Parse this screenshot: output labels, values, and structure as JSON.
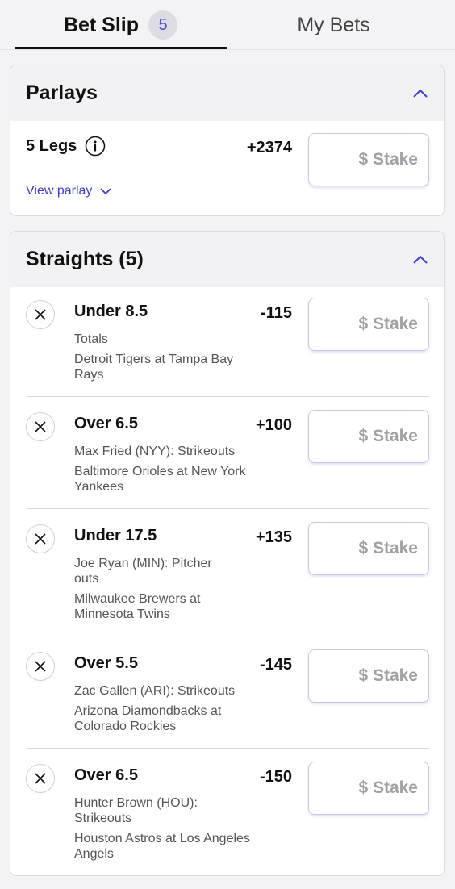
{
  "tabs": {
    "bet_slip_label": "Bet Slip",
    "bet_slip_count": "5",
    "my_bets_label": "My Bets"
  },
  "parlays": {
    "title": "Parlays",
    "legs_label": "5 Legs",
    "odds": "+2374",
    "view_label": "View parlay",
    "stake_placeholder": "$ Stake"
  },
  "straights": {
    "title": "Straights (5)",
    "items": [
      {
        "selection": "Under 8.5",
        "odds": "-115",
        "market": "Totals",
        "event": "Detroit Tigers at Tampa Bay Rays",
        "stake_placeholder": "$ Stake"
      },
      {
        "selection": "Over 6.5",
        "odds": "+100",
        "market": "Max Fried (NYY): Strikeouts",
        "event": "Baltimore Orioles at New York Yankees",
        "stake_placeholder": "$ Stake"
      },
      {
        "selection": "Under 17.5",
        "odds": "+135",
        "market": "Joe Ryan (MIN): Pitcher outs",
        "event": "Milwaukee Brewers at Minnesota Twins",
        "stake_placeholder": "$ Stake"
      },
      {
        "selection": "Over 5.5",
        "odds": "-145",
        "market": "Zac Gallen (ARI): Strikeouts",
        "event": "Arizona Diamondbacks at Colorado Rockies",
        "stake_placeholder": "$ Stake"
      },
      {
        "selection": "Over 6.5",
        "odds": "-150",
        "market": "Hunter Brown (HOU): Strikeouts",
        "event": "Houston Astros at Los Angeles Angels",
        "stake_placeholder": "$ Stake"
      }
    ]
  },
  "icons": {
    "collapse": "chevron-up-icon",
    "expand": "chevron-down-icon",
    "info": "info-icon",
    "remove": "close-icon"
  },
  "colors": {
    "accent": "#3d3dd6",
    "badge_bg": "#dcdce2",
    "stake_border": "#c9c8e4"
  }
}
